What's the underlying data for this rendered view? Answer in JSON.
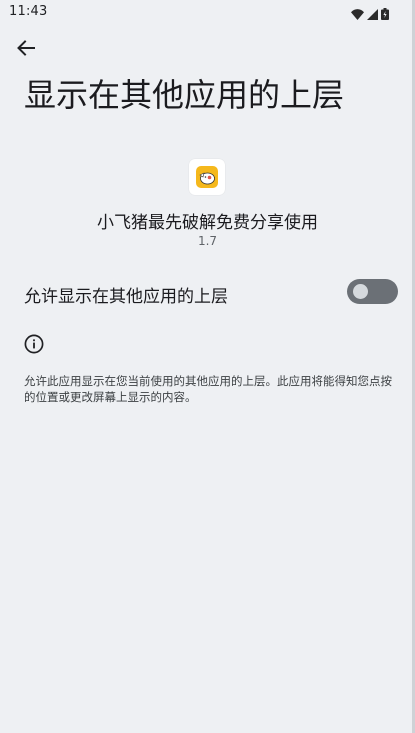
{
  "status_bar": {
    "time": "11:43"
  },
  "header": {
    "back_icon": "arrow-back-icon",
    "title": "显示在其他应用的上层"
  },
  "app": {
    "icon": "app-icon-pig",
    "name": "小飞猪最先破解免费分享使用",
    "version": "1.7"
  },
  "setting": {
    "label": "允许显示在其他应用的上层",
    "enabled": false
  },
  "info": {
    "icon": "info-icon",
    "description": "允许此应用显示在您当前使用的其他应用的上层。此应用将能得知您点按的位置或更改屏幕上显示的内容。"
  },
  "colors": {
    "background": "#eef0f3",
    "toggle_track_off": "#6b7076",
    "toggle_knob_off": "#d5d9dd",
    "app_icon_accent": "#f5b81c"
  }
}
